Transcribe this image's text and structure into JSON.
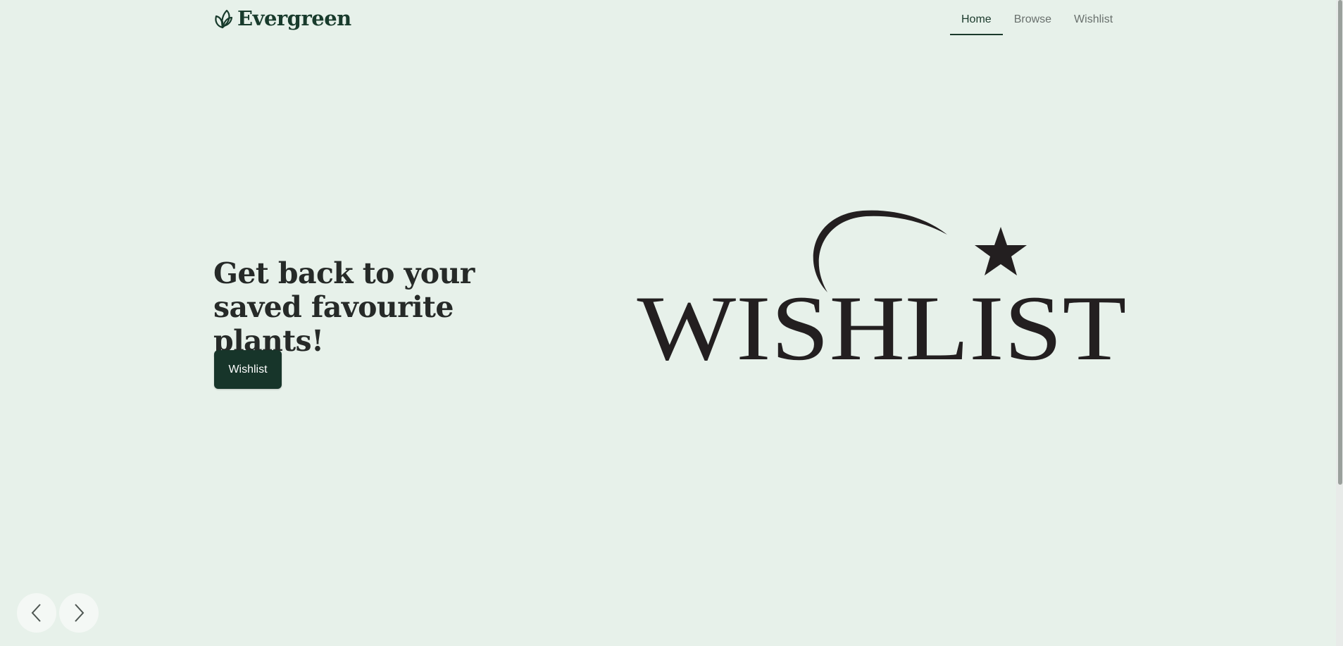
{
  "brand": {
    "name": "Evergreen",
    "icon": "leaf-logo-icon"
  },
  "nav": {
    "items": [
      {
        "label": "Home",
        "active": true
      },
      {
        "label": "Browse",
        "active": false
      },
      {
        "label": "Wishlist",
        "active": false
      }
    ]
  },
  "hero": {
    "title": "Get back to your saved favourite plants!",
    "button_label": "Wishlist",
    "logo_text": "WISHLIST",
    "logo_icon": "star-icon"
  },
  "carousel": {
    "prev_icon": "chevron-left-icon",
    "next_icon": "chevron-right-icon"
  },
  "colors": {
    "background": "#e7f1ea",
    "brand": "#183b2c",
    "button": "#17352a",
    "text": "#262a28",
    "muted": "#69706d"
  }
}
